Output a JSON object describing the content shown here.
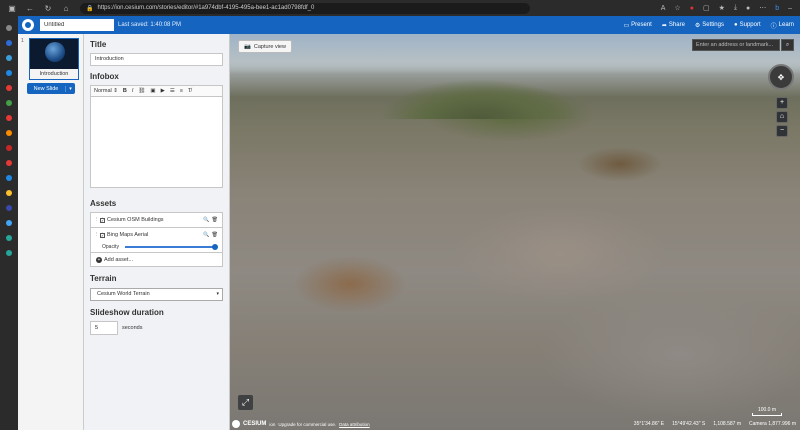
{
  "browser": {
    "url": "https://ion.cesium.com/stories/editor/#1a974dbf-4195-495a-bee1-ac1ad0798fdf_0"
  },
  "header": {
    "story_title": "Untitled",
    "last_saved": "Last saved: 1:40:08 PM",
    "actions": [
      "Present",
      "Share",
      "Settings",
      "Support",
      "Learn"
    ]
  },
  "slides": {
    "number": "1",
    "caption": "Introduction",
    "new_slide_label": "New Slide"
  },
  "editor": {
    "title_heading": "Title",
    "title_value": "Introduction",
    "infobox_heading": "Infobox",
    "format_select": "Normal",
    "assets_heading": "Assets",
    "assets": [
      {
        "name": "Cesium OSM Buildings"
      },
      {
        "name": "Bing Maps Aerial"
      }
    ],
    "opacity_label": "Opacity",
    "opacity_value": 1.0,
    "add_asset_label": "Add asset...",
    "terrain_heading": "Terrain",
    "terrain_value": "Cesium World Terrain",
    "slideshow_heading": "Slideshow duration",
    "duration_value": "5",
    "duration_unit": "seconds"
  },
  "viewer": {
    "capture_label": "Capture view",
    "search_placeholder": "Enter an address or landmark...",
    "cesium_label": "CESIUM",
    "ion_label": "ion",
    "credit_text": "Upgrade for commercial use.",
    "data_attribution": "Data attribution",
    "longitude": "35°1'34.86\" E",
    "latitude": "15°49'42.43\" S",
    "height": "1,108.587 m",
    "camera": "Camera 1,877.996 m",
    "scale": "100.0 m"
  },
  "colors": {
    "brand_blue": "#1565c0",
    "browser_dark": "#2b2b2b"
  }
}
